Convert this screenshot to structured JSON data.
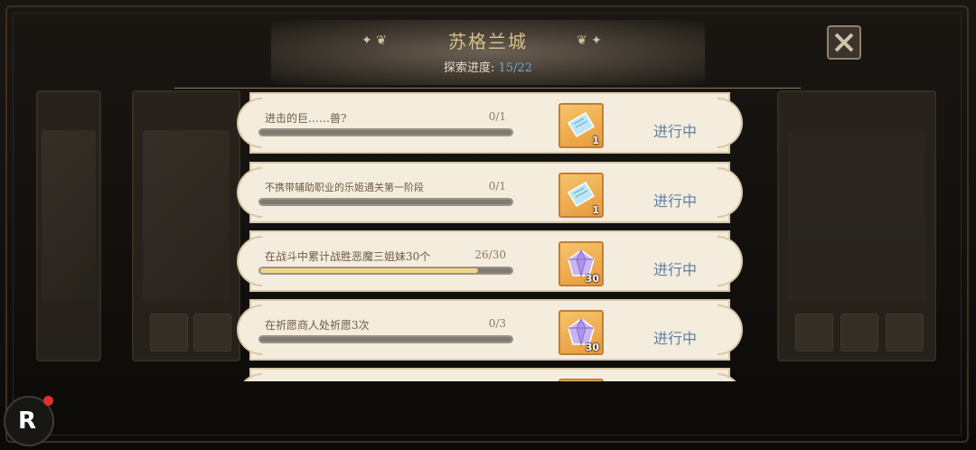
{
  "header": {
    "title": "苏格兰城",
    "progress_label": "探索进度:",
    "progress_value": "15/22"
  },
  "colors": {
    "accent_title": "#d9c08a",
    "progress_value": "#6fa8d8",
    "status_text": "#5d7fa4",
    "bar_fill": "#f0d488"
  },
  "quests": [
    {
      "name": "进击的巨……兽?",
      "count": "0/1",
      "progress": 0.0,
      "reward_icon": "ticket-icon",
      "reward_qty": "1",
      "status": "进行中"
    },
    {
      "name": "不携带辅助职业的乐姬通关第一阶段",
      "count": "0/1",
      "progress": 0.0,
      "reward_icon": "ticket-icon",
      "reward_qty": "1",
      "status": "进行中"
    },
    {
      "name": "在战斗中累计战胜恶魔三姐妹30个",
      "count": "26/30",
      "progress": 0.8667,
      "reward_icon": "diamond-icon",
      "reward_qty": "30",
      "status": "进行中"
    },
    {
      "name": "在祈愿商人处祈愿3次",
      "count": "0/3",
      "progress": 0.0,
      "reward_icon": "diamond-icon",
      "reward_qty": "30",
      "status": "进行中"
    }
  ],
  "logo": {
    "letter": "R"
  }
}
